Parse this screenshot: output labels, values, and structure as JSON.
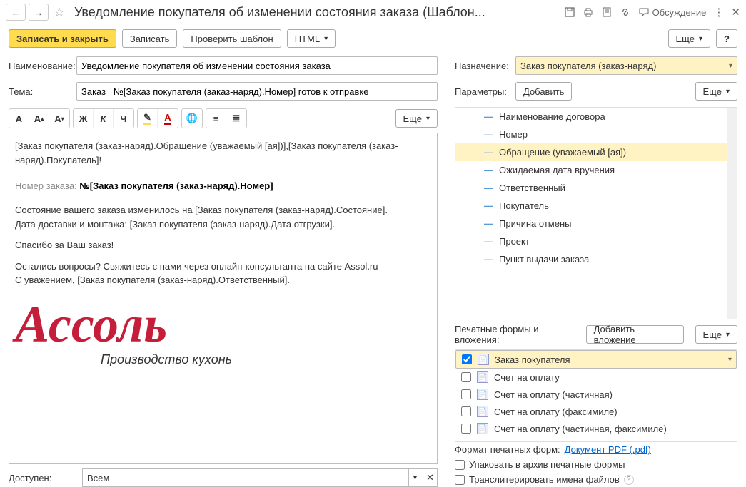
{
  "title": "Уведомление покупателя об изменении состояния заказа (Шаблон...",
  "discuss": "Обсуждение",
  "toolbar": {
    "save_close": "Записать и закрыть",
    "save": "Записать",
    "check": "Проверить шаблон",
    "html": "HTML",
    "more": "Еще"
  },
  "labels": {
    "name": "Наименование:",
    "subject": "Тема:",
    "purpose": "Назначение:",
    "params": "Параметры:",
    "add": "Добавить",
    "available": "Доступен:",
    "attach_hdr": "Печатные формы и вложения:",
    "add_attach": "Добавить вложение",
    "print_fmt": "Формат печатных форм:",
    "pdf_link": "Документ PDF (.pdf)",
    "pack": "Упаковать в архив печатные формы",
    "translit": "Транслитерировать имена файлов"
  },
  "fields": {
    "name": "Уведомление покупателя об изменении состояния заказа",
    "subject": "Заказ   №[Заказ покупателя (заказ-наряд).Номер] готов к отправке",
    "purpose": "Заказ покупателя (заказ-наряд)",
    "available": "Всем"
  },
  "body": {
    "greet": "[Заказ покупателя (заказ-наряд).Обращение (уважаемый [ая])],[Заказ покупателя (заказ-наряд).Покупатель]!",
    "ordlbl": "Номер заказа:  ",
    "ordval": "№[Заказ покупателя (заказ-наряд).Номер]",
    "l1": "Состояние вашего заказа   изменилось на [Заказ покупателя (заказ-наряд).Состояние].",
    "l2": "Дата доставки и монтажа: [Заказ покупателя (заказ-наряд).Дата отгрузки].",
    "l3": "Спасибо за Ваш заказ!",
    "l4": "Остались вопросы? Свяжитесь с нами через онлайн-консультанта на сайте Assol.ru",
    "l5": "С уважением, [Заказ покупателя (заказ-наряд).Ответственный].",
    "logo": "Ассоль",
    "logo_sub": "Производство кухонь"
  },
  "params": [
    "Наименование договора",
    "Номер",
    "Обращение (уважаемый [ая])",
    "Ожидаемая дата вручения",
    "Ответственный",
    "Покупатель",
    "Причина отмены",
    "Проект",
    "Пункт выдачи заказа"
  ],
  "attachments": [
    {
      "label": "Заказ покупателя",
      "checked": true
    },
    {
      "label": "Счет на оплату",
      "checked": false
    },
    {
      "label": "Счет на оплату (частичная)",
      "checked": false
    },
    {
      "label": "Счет на оплату (факсимиле)",
      "checked": false
    },
    {
      "label": "Счет на оплату (частичная, факсимиле)",
      "checked": false
    }
  ]
}
